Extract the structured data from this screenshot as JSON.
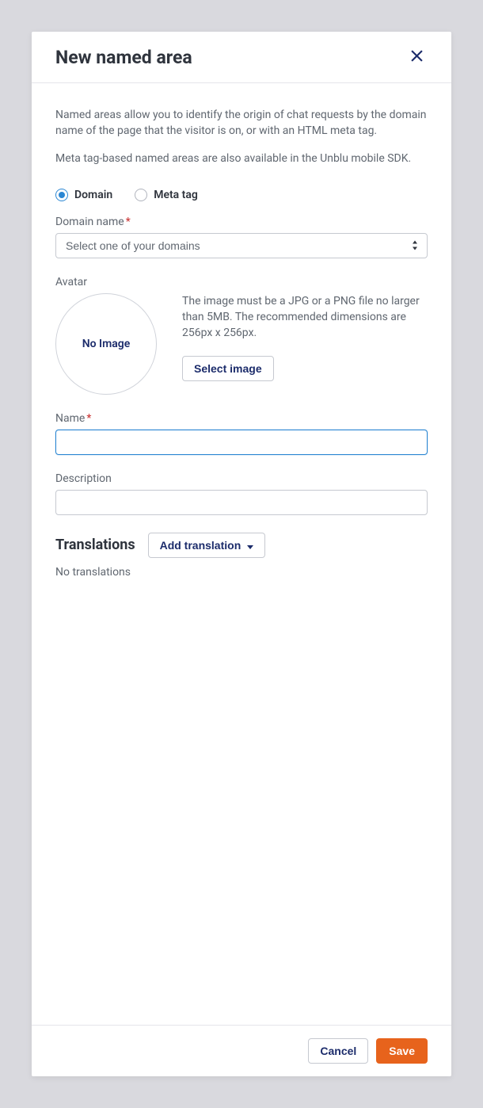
{
  "header": {
    "title": "New named area"
  },
  "intro": {
    "p1": "Named areas allow you to identify the origin of chat requests by the domain name of the page that the visitor is on, or with an HTML meta tag.",
    "p2": "Meta tag-based named areas are also available in the Unblu mobile SDK."
  },
  "type_radio": {
    "selected": "domain",
    "domain_label": "Domain",
    "meta_label": "Meta tag"
  },
  "domain_field": {
    "label": "Domain name",
    "placeholder": "Select one of your domains"
  },
  "avatar": {
    "label": "Avatar",
    "circle_text": "No Image",
    "hint": "The image must be a JPG or a PNG file no larger than 5MB. The recommended dimensions are 256px x 256px.",
    "button": "Select image"
  },
  "name_field": {
    "label": "Name",
    "value": ""
  },
  "description_field": {
    "label": "Description",
    "value": ""
  },
  "translations": {
    "title": "Translations",
    "add_button": "Add translation",
    "empty": "No translations"
  },
  "footer": {
    "cancel": "Cancel",
    "save": "Save"
  }
}
